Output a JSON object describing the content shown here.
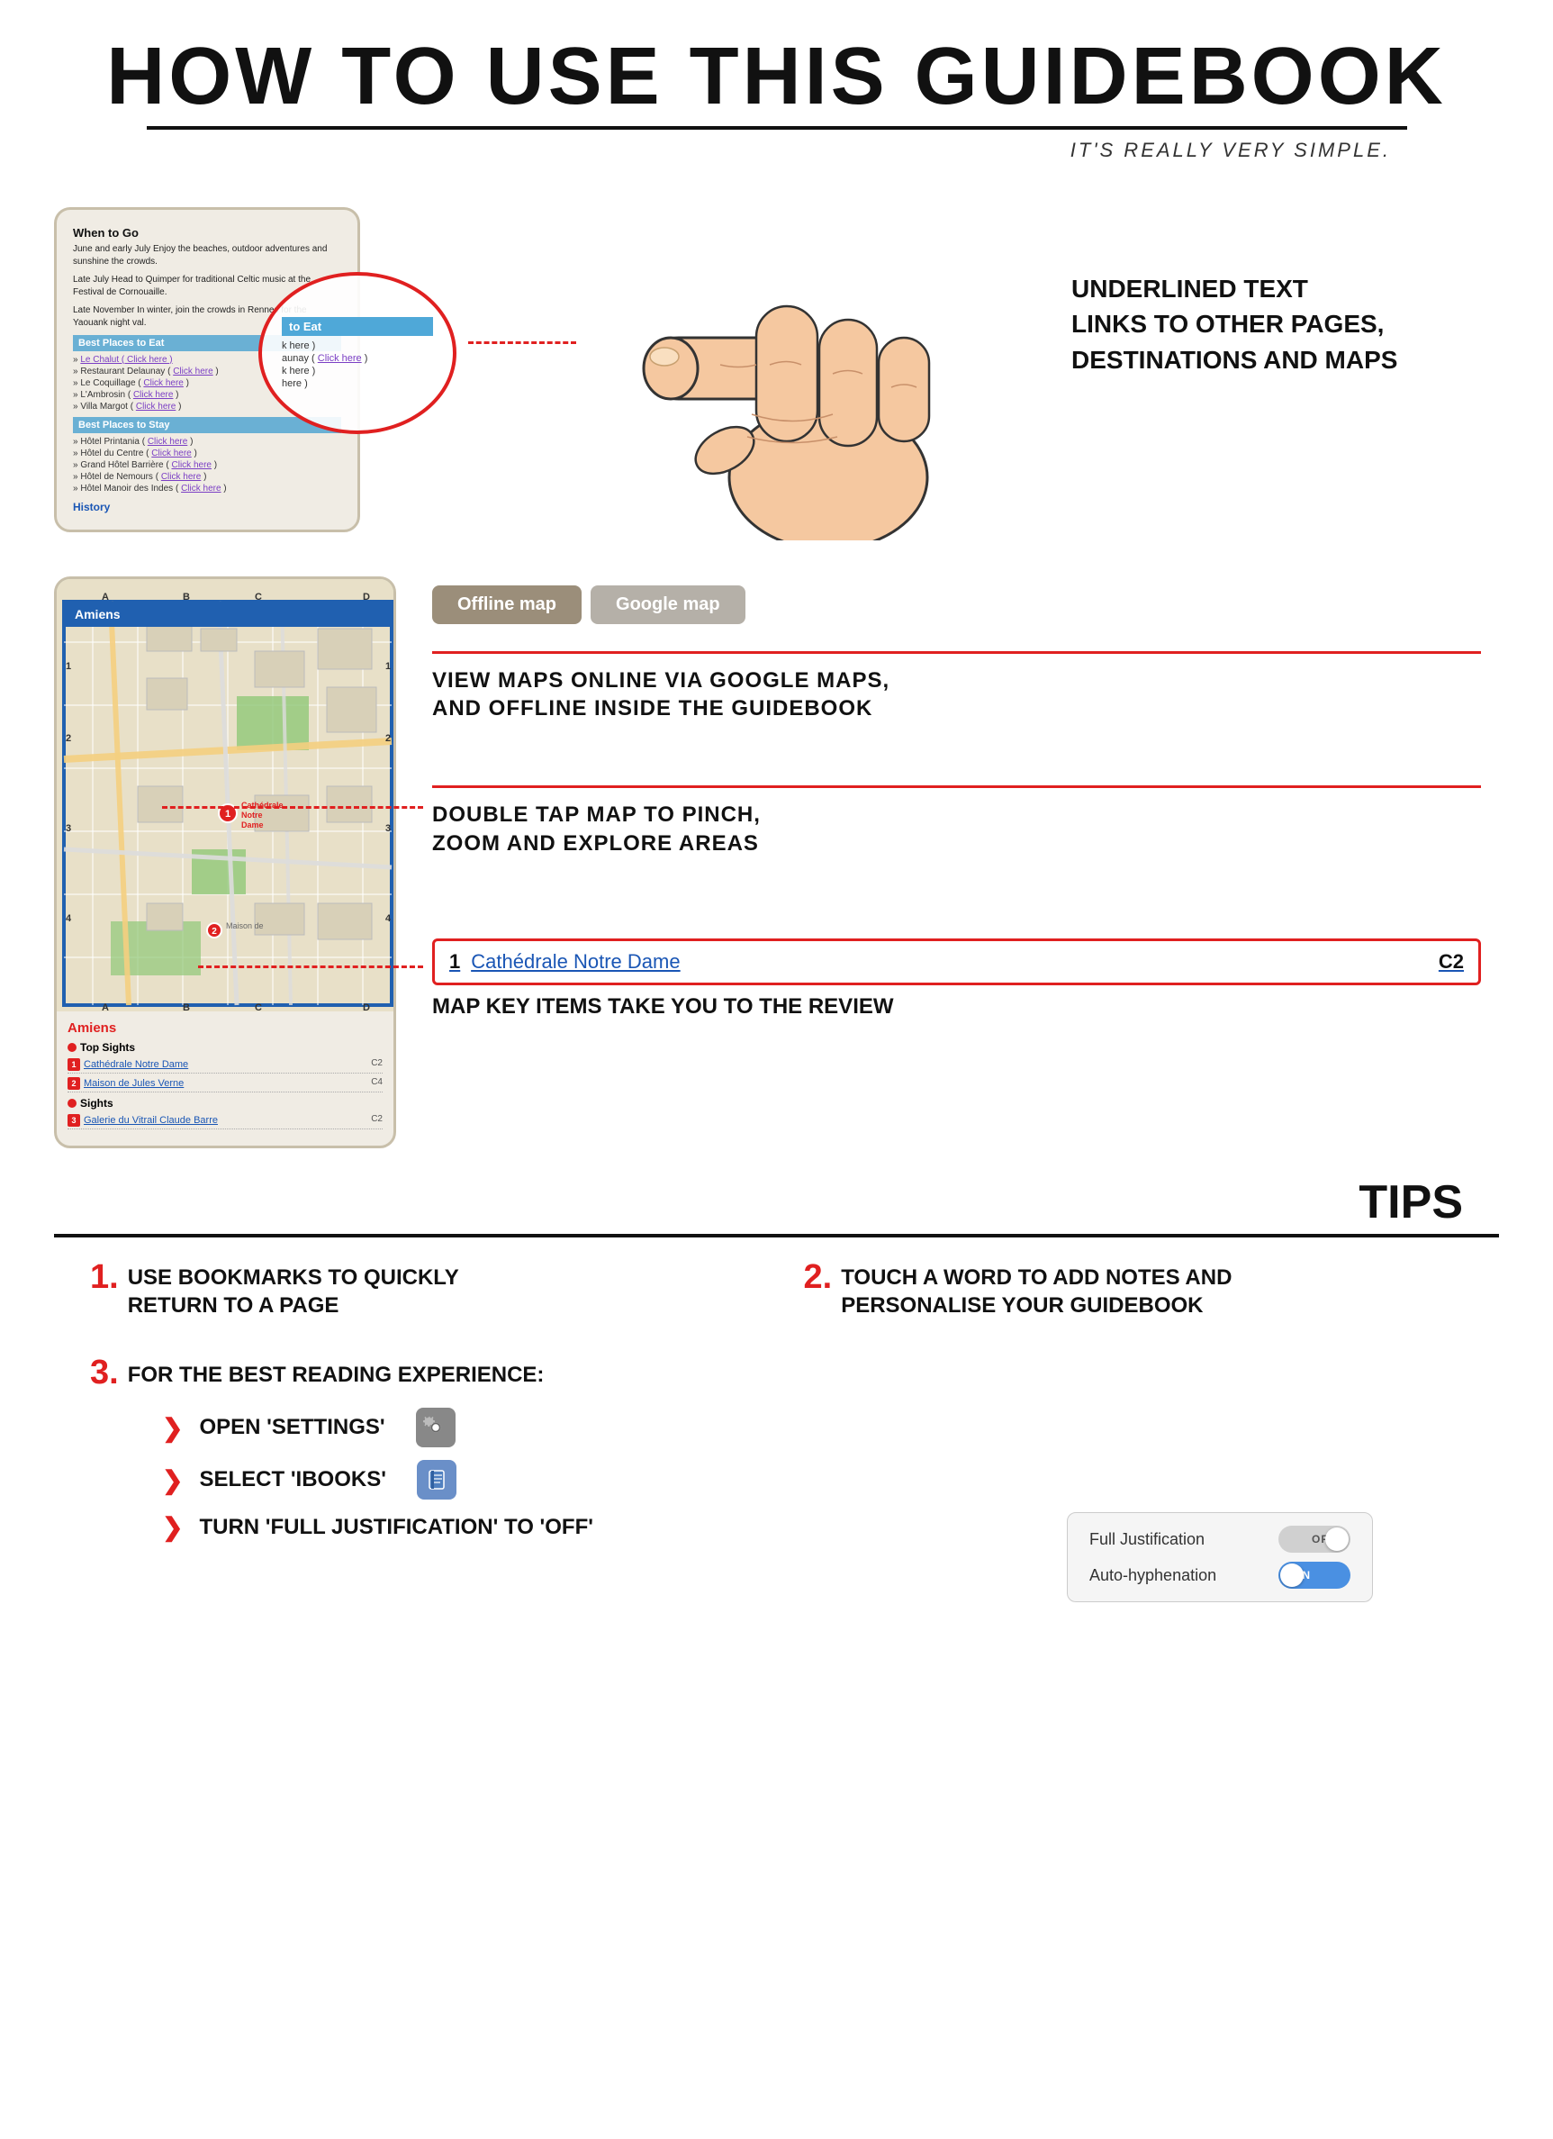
{
  "header": {
    "title": "HOW TO USE THIS GUIDEBOOK",
    "subtitle": "IT'S REALLY VERY SIMPLE."
  },
  "section1": {
    "phone": {
      "when_to_go_title": "When to Go",
      "when_to_go_text1": "June and early July Enjoy the beaches, outdoor adventures and sunshine the crowds.",
      "when_to_go_text2": "Late July Head to Quimper for traditional Celtic music at the Festival de Cornouaille.",
      "when_to_go_text3": "Late November In winter, join the crowds in Rennes for the Yaouank night val.",
      "best_eat_title": "Best Places to Eat",
      "places_eat": [
        {
          "name": "Le Chalut ( Click here )",
          "highlighted": true
        },
        {
          "name": "Restaurant Delaunay ( Click here )"
        },
        {
          "name": "Le Coquillage ( Click here )"
        },
        {
          "name": "L'Ambrosin ( Click here )"
        },
        {
          "name": "Villa Margot ( Click here )"
        }
      ],
      "best_stay_title": "Best Places to Stay",
      "places_stay": [
        {
          "name": "Hôtel Printania ( Click here )"
        },
        {
          "name": "Hôtel du Centre ( Click here )"
        },
        {
          "name": "Grand Hôtel Barrière ( Click here )"
        },
        {
          "name": "Hôtel de Nemours ( Click here )"
        },
        {
          "name": "Hôtel Manoir des Indes ( Click here )"
        }
      ],
      "history_link": "History"
    },
    "circle_overlay": {
      "bar_text": "to Eat",
      "items": [
        "k here )",
        "aunay ( Click here )",
        "k here )",
        "here )"
      ]
    },
    "description": "UNDERLINED TEXT\nLINKS TO OTHER PAGES,\nDESTINATIONS AND MAPS",
    "click_here_text": "Click here"
  },
  "section2": {
    "map_title": "Amiens",
    "btn_offline": "Offline map",
    "btn_google": "Google map",
    "desc1": "VIEW MAPS ONLINE VIA GOOGLE MAPS,\nAND OFFLINE INSIDE THE GUIDEBOOK",
    "desc2": "DOUBLE TAP MAP TO PINCH,\nZOOM AND EXPLORE AREAS",
    "key_item": {
      "number": "1",
      "name": "Cathédrale Notre Dame",
      "coord": "C2"
    },
    "key_desc": "MAP KEY ITEMS TAKE YOU TO THE REVIEW",
    "map_key_section_title": "Amiens",
    "top_sights_title": "Top Sights",
    "top_sights": [
      {
        "num": "1",
        "name": "Cathédrale Notre Dame",
        "coord": "C2"
      },
      {
        "num": "2",
        "name": "Maison de Jules Verne",
        "coord": "C4"
      }
    ],
    "sights_title": "Sights",
    "sights": [
      {
        "num": "3",
        "name": "Galerie du Vitrail Claude Barre",
        "coord": "C2"
      }
    ]
  },
  "tips": {
    "header": "TIPS",
    "tip1": {
      "number": "1.",
      "text": "USE BOOKMARKS TO QUICKLY\nRETURN TO A PAGE"
    },
    "tip2": {
      "number": "2.",
      "text": "TOUCH A WORD TO ADD NOTES AND\nPERSONALISE YOUR GUIDEBOOK"
    },
    "tip3": {
      "number": "3.",
      "text": "FOR THE BEST READING EXPERIENCE:",
      "items": [
        {
          "text": "Open 'Settings'",
          "icon": "gear"
        },
        {
          "text": "Select 'iBooks'",
          "icon": "book"
        },
        {
          "text": "Turn 'Full Justification' to 'off'",
          "icon": null
        }
      ]
    },
    "toggles": [
      {
        "label": "Full Justification",
        "state": "OFF"
      },
      {
        "label": "Auto-hyphenation",
        "state": "ON"
      }
    ]
  }
}
